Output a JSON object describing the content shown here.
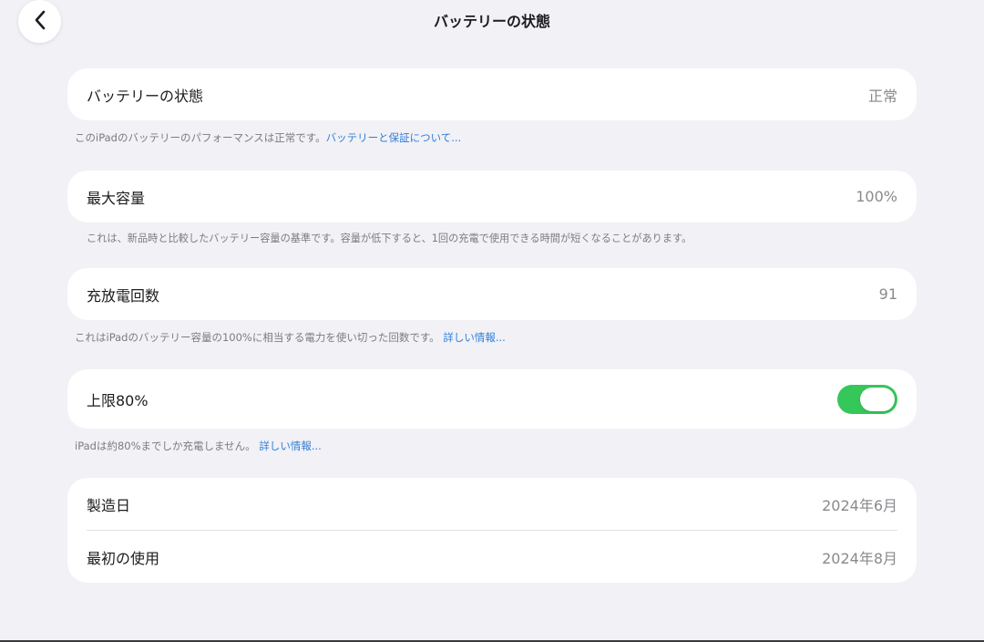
{
  "header": {
    "title": "バッテリーの状態",
    "back_icon": "chevron-left-icon"
  },
  "battery_health": {
    "label": "バッテリーの状態",
    "value": "正常",
    "footnote_text": "このiPadのバッテリーのパフォーマンスは正常です。",
    "footnote_link": "バッテリーと保証について..."
  },
  "max_capacity": {
    "label": "最大容量",
    "value": "100%",
    "footnote_text": "これは、新品時と比較したバッテリー容量の基準です。容量が低下すると、1回の充電で使用できる時間が短くなることがあります。"
  },
  "cycle_count": {
    "label": "充放電回数",
    "value": "91",
    "footnote_text": "これはiPadのバッテリー容量の100%に相当する電力を使い切った回数です。",
    "footnote_link": "詳しい情報..."
  },
  "limit_80": {
    "label": "上限80%",
    "toggle_on": true,
    "toggle_color": "#35c759",
    "footnote_text": "iPadは約80%までしか充電しません。",
    "footnote_link": "詳しい情報..."
  },
  "dates": {
    "manufacture_label": "製造日",
    "manufacture_value": "2024年6月",
    "first_use_label": "最初の使用",
    "first_use_value": "2024年8月"
  },
  "colors": {
    "background": "#f1f1f6",
    "link": "#2f7ed8"
  }
}
